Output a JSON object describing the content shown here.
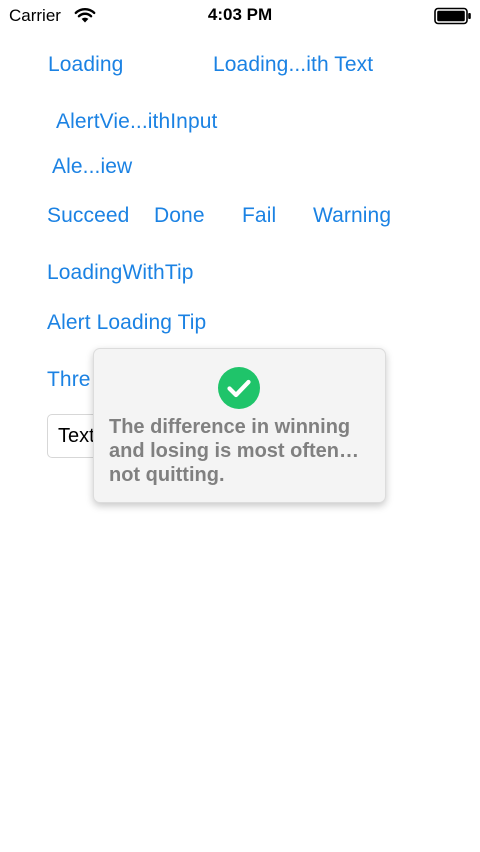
{
  "status_bar": {
    "carrier": "Carrier",
    "time": "4:03 PM",
    "wifi_icon": "wifi-icon",
    "battery_icon": "battery-icon"
  },
  "buttons": {
    "loading": "Loading",
    "loading_with_text": "Loading...ith Text",
    "alert_view_with_input": "AlertVie...ithInput",
    "alert_view": "Ale...iew",
    "succeed": "Succeed",
    "done": "Done",
    "fail": "Fail",
    "warning": "Warning",
    "loading_with_tip": "LoadingWithTip",
    "alert_loading_tip": "Alert Loading Tip",
    "three": "Thre"
  },
  "text_field": {
    "value": "Text"
  },
  "toast": {
    "icon": "checkmark-circle-icon",
    "message": "The difference in winning and losing is most often… not quitting."
  },
  "colors": {
    "link": "#1b82e3",
    "success_green": "#1fc46a",
    "toast_text": "#808080",
    "toast_bg": "#f4f4f4"
  }
}
